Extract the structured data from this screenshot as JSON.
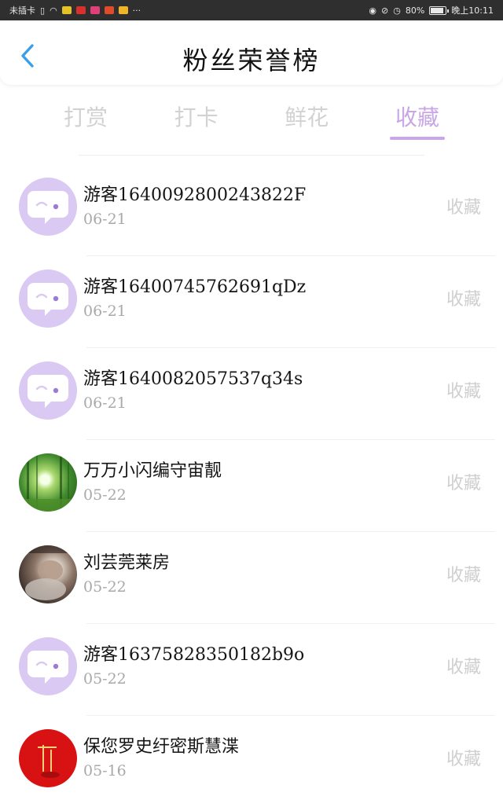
{
  "status_bar": {
    "carrier": "未插卡",
    "battery": "80%",
    "battery_level": 0.8,
    "time": "晚上10:11",
    "more": "···"
  },
  "header": {
    "title": "粉丝荣誉榜"
  },
  "tabs": [
    {
      "label": "打赏",
      "active": false
    },
    {
      "label": "打卡",
      "active": false
    },
    {
      "label": "鲜花",
      "active": false
    },
    {
      "label": "收藏",
      "active": true
    }
  ],
  "colors": {
    "accent": "#c9a6e6",
    "avatar_chat_bg": "#d9c9f3",
    "inactive_text": "#d2d2d2",
    "date_text": "#a9a9a9"
  },
  "list": [
    {
      "name": "游客16400928002438​22F",
      "date": "06-21",
      "action": "收藏",
      "avatar": "chat-icon"
    },
    {
      "name": "游客16400745762691qDz",
      "date": "06-21",
      "action": "收藏",
      "avatar": "chat-icon"
    },
    {
      "name": "游客1640082057537q34s",
      "date": "06-21",
      "action": "收藏",
      "avatar": "chat-icon"
    },
    {
      "name": "万万小闪编守宙靓",
      "date": "05-22",
      "action": "收藏",
      "avatar": "forest-photo"
    },
    {
      "name": "刘芸莞莱房",
      "date": "05-22",
      "action": "收藏",
      "avatar": "person-photo"
    },
    {
      "name": "游客1637582835018​2b9o",
      "date": "05-22",
      "action": "收藏",
      "avatar": "chat-icon"
    },
    {
      "name": "保您罗史纡密斯慧渫",
      "date": "05-16",
      "action": "收藏",
      "avatar": "red-photo"
    }
  ]
}
